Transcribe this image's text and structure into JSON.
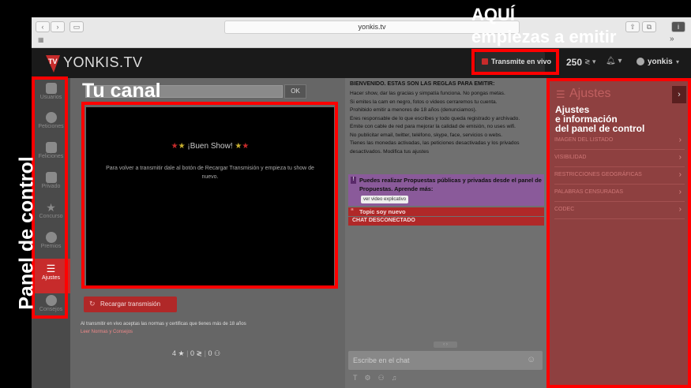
{
  "browser": {
    "url": "yonkis.tv"
  },
  "header": {
    "logo": "YONKIS.TV",
    "transmit_button": "Transmite en vivo",
    "coins": "250",
    "username": "yonkis"
  },
  "sidebar": {
    "items": [
      {
        "label": "Usuarios",
        "icon": "users-icon"
      },
      {
        "label": "Peticiones",
        "icon": "bulb-icon"
      },
      {
        "label": "Feliciones",
        "icon": "thumbs-up-icon"
      },
      {
        "label": "Privado",
        "icon": "lock-icon"
      },
      {
        "label": "Concurso",
        "icon": "star-icon"
      },
      {
        "label": "Premios",
        "icon": "dollar-icon"
      },
      {
        "label": "Ajustes",
        "icon": "list-icon",
        "active": true
      },
      {
        "label": "Consejos",
        "icon": "question-icon"
      }
    ]
  },
  "channel": {
    "ok_button": "OK",
    "video_title": "¡Buen Show!",
    "video_message": "Para volver a transmitir dale al botón de Recargar Transmisión y empieza tu show de nuevo.",
    "reload_button": "Recargar transmisión",
    "terms_text": "Al transmitir en vivo aceptas las normas y certificas que tienes más de 18 años",
    "terms_link": "Leer Normas y Consejos",
    "stats": [
      "4",
      "0",
      "0"
    ]
  },
  "rules": {
    "heading": "BIENVENIDO. ESTAS SON LAS REGLAS PARA EMITIR:",
    "lines": [
      "Hacer show, dar las gracias y simpatía funciona. No pongas metas.",
      "Si emites la cam en negro, fotos o videos cerraremos tu cuenta.",
      "Prohibido emitir a menores de 18 años (denunciamos).",
      "Eres responsable de lo que escribes y todo queda registrado y archivado.",
      "Emite con cable de red para mejorar la calidad de emisión, no uses wifi.",
      "No publicitar email, twitter, teléfono, skype, face, servicios o webs.",
      "Tienes las monedas activadas, las peticiones desactivadas y los privados desactivados. Modifica tus ajustes"
    ],
    "proposals": "Puedes realizar Propuestas públicas y privadas desde el panel de Propuestas. Aprende más:",
    "video_link": "ver video explicativo",
    "topic": "Topic soy nuevo",
    "chat_status": "CHAT DESCONECTADO",
    "chat_placeholder": "Escribe en el chat"
  },
  "settings": {
    "title": "Ajustes",
    "rows": [
      "IMAGEN DEL LISTADO",
      "VISIBILIDAD",
      "RESTRICCIONES GEOGRÁFICAS",
      "PALABRAS CENSURADAS",
      "CODEC"
    ]
  },
  "annotations": {
    "left_panel": "Panel de control",
    "channel": "Tu canal",
    "emit_line1": "AQUÍ",
    "emit_line2": "empiezas a emitir",
    "settings_line1": "Ajustes",
    "settings_line2": "e información",
    "settings_line3": "del panel de control"
  },
  "colors": {
    "highlight": "#ff0000",
    "accent_red": "#c72b2b",
    "proposal_purple": "#8a5a9a"
  }
}
